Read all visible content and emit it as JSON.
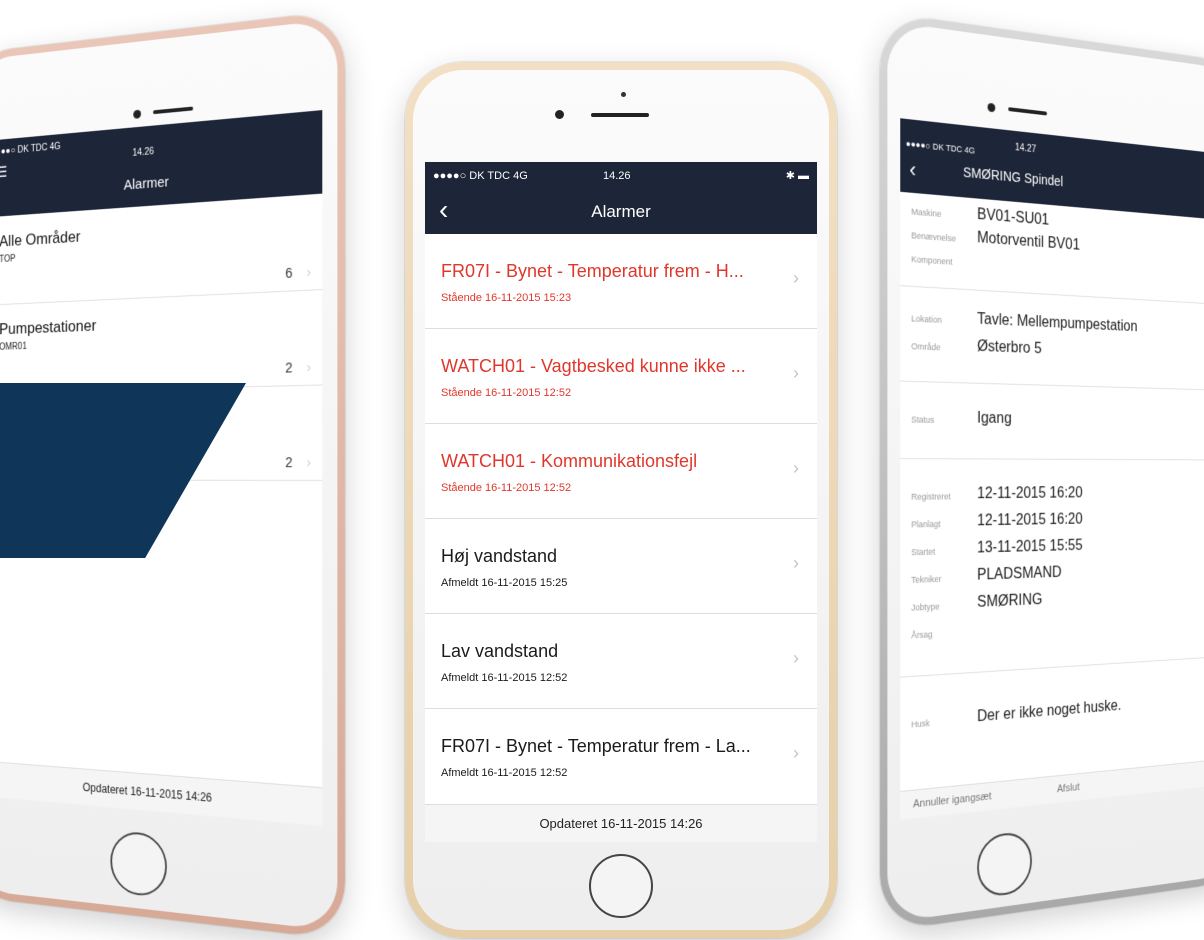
{
  "left_phone": {
    "status": {
      "carrier": "●●●●○ DK TDC  4G",
      "time": "14.26"
    },
    "menu_icon": "hamburger-icon",
    "title": "Alarmer",
    "rows": [
      {
        "title": "Alle Områder",
        "subtitle": "TOP",
        "count": "6"
      },
      {
        "title": "Pumpestationer",
        "subtitle": "OMR01",
        "count": "2"
      },
      {
        "title": "",
        "subtitle": "",
        "count": "2"
      }
    ],
    "footer": "Opdateret 16-11-2015 14:26"
  },
  "center_phone": {
    "status": {
      "carrier": "●●●●○ DK TDC  4G",
      "time": "14.26",
      "right": "✱ ▬"
    },
    "back_icon": "chevron-left-icon",
    "title": "Alarmer",
    "alarms": [
      {
        "title": "FR07I - Bynet - Temperatur frem - H...",
        "sub": "Stående 16-11-2015 15:23",
        "state": "red"
      },
      {
        "title": "WATCH01 - Vagtbesked kunne ikke ...",
        "sub": "Stående 16-11-2015 12:52",
        "state": "red"
      },
      {
        "title": "WATCH01 - Kommunikationsfejl",
        "sub": "Stående 16-11-2015 12:52",
        "state": "red"
      },
      {
        "title": "Høj vandstand",
        "sub": "Afmeldt 16-11-2015 15:25",
        "state": "black"
      },
      {
        "title": "Lav vandstand",
        "sub": "Afmeldt 16-11-2015 12:52",
        "state": "black"
      },
      {
        "title": "FR07I - Bynet - Temperatur frem - La...",
        "sub": "Afmeldt 16-11-2015 12:52",
        "state": "black"
      }
    ],
    "footer": "Opdateret 16-11-2015 14:26"
  },
  "right_phone": {
    "status": {
      "carrier": "●●●●○ DK TDC  4G",
      "time": "14.27"
    },
    "title": "SMØRING Spindel",
    "fields": {
      "maskine": {
        "k": "Maskine",
        "v": "BV01-SU01"
      },
      "benaevnelse": {
        "k": "Benævnelse",
        "v": "Motorventil BV01"
      },
      "komponent": {
        "k": "Komponent",
        "v": ""
      },
      "lokation": {
        "k": "Lokation",
        "v": "Tavle: Mellempumpestation"
      },
      "omraade": {
        "k": "Område",
        "v": "Østerbro 5"
      },
      "status": {
        "k": "Status",
        "v": "Igang"
      },
      "registreret": {
        "k": "Registreret",
        "v": "12-11-2015 16:20"
      },
      "planlagt": {
        "k": "Planlagt",
        "v": "12-11-2015 16:20"
      },
      "startet": {
        "k": "Startet",
        "v": "13-11-2015 15:55"
      },
      "tekniker": {
        "k": "Tekniker",
        "v": "PLADSMAND"
      },
      "jobtype": {
        "k": "Jobtype",
        "v": "SMØRING"
      },
      "aarsag": {
        "k": "Årsag",
        "v": ""
      },
      "husk": {
        "k": "Husk",
        "v": "Der er ikke noget huske."
      }
    },
    "footer_buttons": {
      "cancel": "Annuller igangsæt",
      "finish": "Afslut"
    }
  },
  "colors": {
    "navbar": "#1d2538",
    "alarm_red": "#e0372c",
    "brand": "#0f3558"
  }
}
